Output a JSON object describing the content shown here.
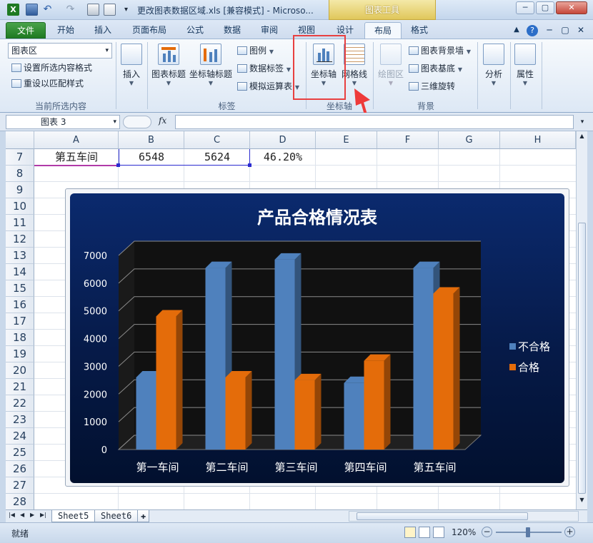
{
  "window": {
    "title": "更改图表数据区域.xls  [兼容模式] - Microso...",
    "contextual_header": "图表工具"
  },
  "tabs": [
    "文件",
    "开始",
    "插入",
    "页面布局",
    "公式",
    "数据",
    "审阅",
    "视图",
    "设计",
    "布局",
    "格式"
  ],
  "ribbon": {
    "selection_dropdown": "图表区",
    "format_selection": "设置所选内容格式",
    "reset_style": "重设以匹配样式",
    "group_current": "当前所选内容",
    "insert": "插入",
    "chart_title": "图表标题",
    "axis_title": "坐标轴标题",
    "legend": "图例",
    "data_labels": "数据标签",
    "data_table": "模拟运算表",
    "group_labels": "标签",
    "axes": "坐标轴",
    "gridlines": "网格线",
    "group_axes": "坐标轴",
    "plot_area": "绘图区",
    "chart_wall": "图表背景墙",
    "chart_floor": "图表基底",
    "rotation": "三维旋转",
    "group_background": "背景",
    "analysis": "分析",
    "properties": "属性"
  },
  "formula_bar": {
    "name_box": "图表 3",
    "fx": "fx"
  },
  "columns": [
    "A",
    "B",
    "C",
    "D",
    "E",
    "F",
    "G",
    "H"
  ],
  "rows": [
    "7",
    "8",
    "9",
    "10",
    "11",
    "12",
    "13",
    "14",
    "15",
    "16",
    "17",
    "18",
    "19",
    "20",
    "21",
    "22",
    "23",
    "24",
    "25",
    "26",
    "27",
    "28"
  ],
  "row7": {
    "a": "第五车间",
    "b": "6548",
    "c": "5624",
    "d": "46.20%"
  },
  "chart_data": {
    "type": "bar",
    "title": "产品合格情况表",
    "categories": [
      "第一车间",
      "第二车间",
      "第三车间",
      "第四车间",
      "第五车间"
    ],
    "series": [
      {
        "name": "不合格",
        "values": [
          2600,
          6548,
          6850,
          2400,
          6548
        ]
      },
      {
        "name": "合格",
        "values": [
          4800,
          2600,
          2500,
          3200,
          5624
        ]
      }
    ],
    "ylim": [
      0,
      7000
    ],
    "yticks": [
      "0",
      "1000",
      "2000",
      "3000",
      "4000",
      "5000",
      "6000",
      "7000"
    ],
    "grid": true,
    "legend_position": "right",
    "colors": {
      "series0": "#4f81bd",
      "series1": "#e46c0a",
      "title": "#ffffff"
    }
  },
  "sheets": [
    "Sheet5",
    "Sheet6"
  ],
  "status": {
    "ready": "就绪",
    "zoom": "120%"
  }
}
